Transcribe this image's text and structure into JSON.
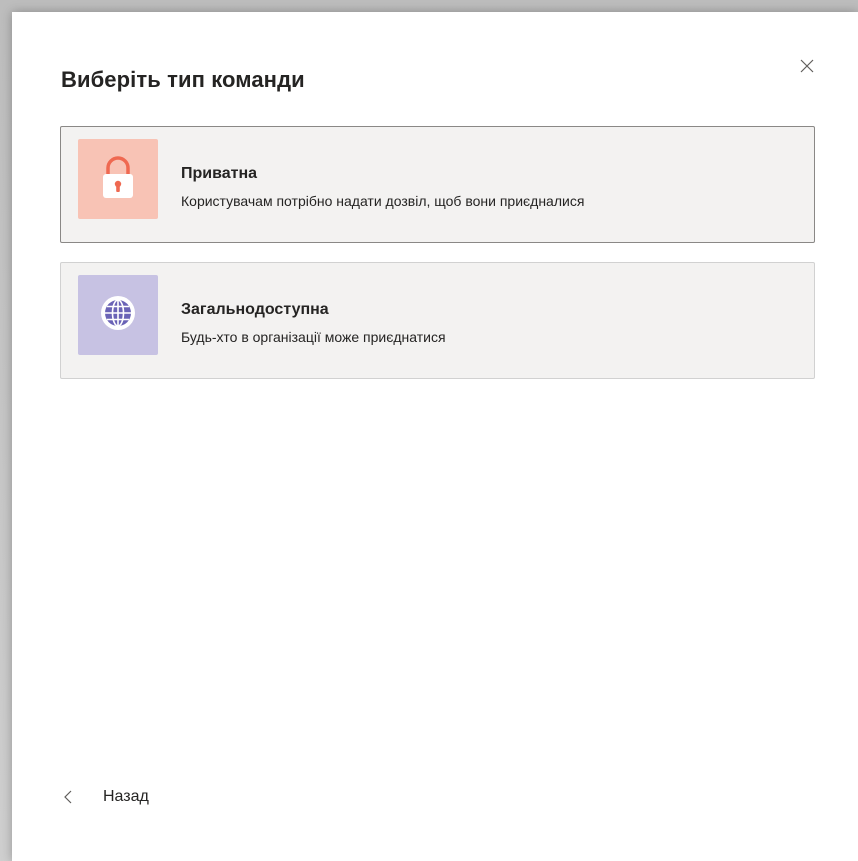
{
  "dialog": {
    "title": "Виберіть тип команди",
    "close_icon": "close-icon"
  },
  "options": [
    {
      "title": "Приватна",
      "description": "Користувачам потрібно надати дозвіл, щоб вони приєдналися",
      "icon": "lock-icon",
      "tile_color": "#f8c3b5",
      "icon_color": "#ef6951",
      "selected": true
    },
    {
      "title": "Загальнодоступна",
      "description": "Будь-хто в організації може приєднатися",
      "icon": "globe-icon",
      "tile_color": "#c7c2e3",
      "icon_color": "#6a63b6",
      "selected": false
    }
  ],
  "footer": {
    "back_label": "Назад",
    "back_icon": "chevron-left-icon"
  },
  "colors": {
    "text": "#252423",
    "card_bg": "#f3f2f1",
    "card_border": "#d1d1d1",
    "selected_border": "#8a8886"
  }
}
